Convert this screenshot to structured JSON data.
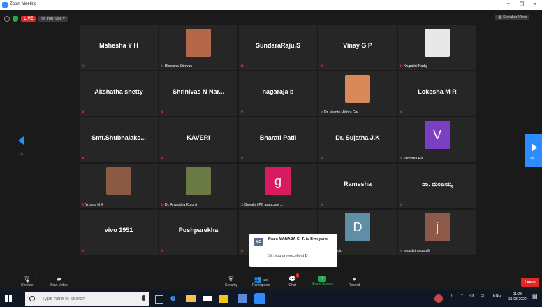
{
  "window": {
    "title": "Zoom Meeting",
    "controls": [
      "–",
      "❐",
      "✕"
    ]
  },
  "topbar": {
    "live": "LIVE",
    "on_youtube": "on YouTube",
    "speaker_view": "Speaker View"
  },
  "pager": {
    "left_text": "4/6",
    "right_text": "4/6"
  },
  "tiles": [
    {
      "big": "Mshesha Y H",
      "small": ""
    },
    {
      "big": "",
      "small": "Bhuvana Srinivas",
      "photo": "#b5674a"
    },
    {
      "big": "SundaraRaju.S",
      "small": ""
    },
    {
      "big": "Vinay G P",
      "small": ""
    },
    {
      "big": "",
      "small": "Krupalini Nadig",
      "photo": "#e8e8e8"
    },
    {
      "big": "Akshatha shetty",
      "small": ""
    },
    {
      "big": "Shrinivas N Nar...",
      "small": ""
    },
    {
      "big": "nagaraja b",
      "small": ""
    },
    {
      "big": "",
      "small": "Dr. Mamta Mishra Gw...",
      "photo": "#d9885a"
    },
    {
      "big": "Lokesha M R",
      "small": ""
    },
    {
      "big": "Smt.Shubhalaks...",
      "small": ""
    },
    {
      "big": "KAVERI",
      "small": ""
    },
    {
      "big": "Bharati Patil",
      "small": ""
    },
    {
      "big": "Dr. Sujatha.J.K",
      "small": ""
    },
    {
      "big": "",
      "small": "vandana Rai",
      "avatar": "V",
      "avatar_color": "#7b3fc4"
    },
    {
      "big": "",
      "small": "Vrunda N K",
      "photo": "#8a5a45"
    },
    {
      "big": "",
      "small": "Dr. Anuradha Kurunji",
      "photo": "#6b7a45"
    },
    {
      "big": "",
      "small": "Gayathri PC associate ...",
      "avatar": "g",
      "avatar_color": "#d81b60"
    },
    {
      "big": "Ramesha",
      "small": ""
    },
    {
      "big": "ಡಾ. ಮಂಜಯ್ಯ",
      "small": ""
    },
    {
      "big": "vivo 1951",
      "small": ""
    },
    {
      "big": "Pushparekha",
      "small": ""
    },
    {
      "big": "",
      "small": ""
    },
    {
      "big": "",
      "small": "ing to audio",
      "avatar": "D",
      "avatar_color": "#5f8fa6"
    },
    {
      "big": "",
      "small": "jayashri nagaralli",
      "avatar": "j",
      "avatar_color": "#8d5a4a"
    }
  ],
  "chat": {
    "initials": "MC",
    "from": "From MANASA C. T. to Everyone",
    "message": "Sir, you are excellent D"
  },
  "controls": {
    "unmute": "Unmute",
    "start_video": "Start Video",
    "security": "Security",
    "participants": "Participants",
    "participants_count": "185",
    "chat": "Chat",
    "chat_badge": "1",
    "share_screen": "Share Screen",
    "record": "Record",
    "leave": "Leave"
  },
  "taskbar": {
    "search_placeholder": "Type here to search",
    "lang": "ENG",
    "time": "11:23",
    "date": "31-08-2020"
  },
  "colors": {
    "accent": "#2d8cff",
    "leave": "#e02828",
    "share": "#23a94f"
  }
}
